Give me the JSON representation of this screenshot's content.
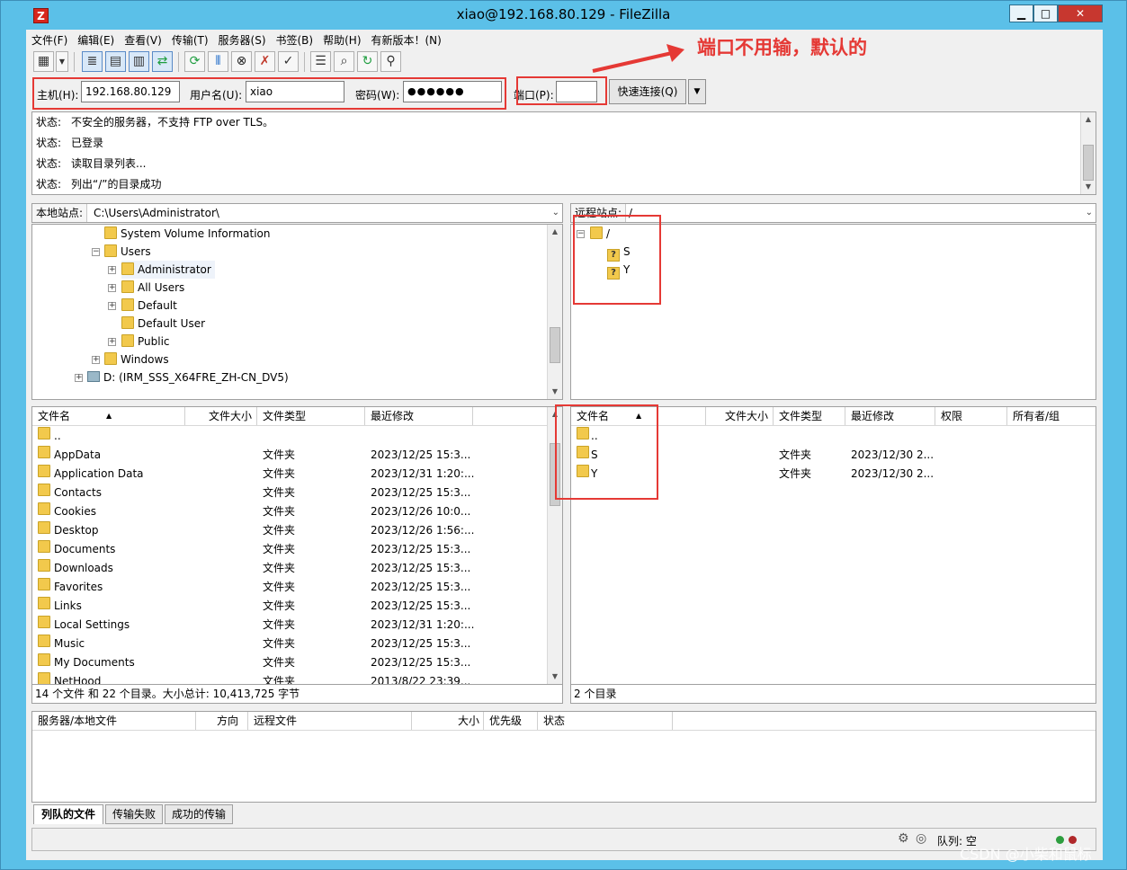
{
  "window": {
    "title": "xiao@192.168.80.129 - FileZilla",
    "app_icon_glyph": "Z",
    "minimize": "▁",
    "maximize": "□",
    "close": "✕"
  },
  "menu": [
    "文件(F)",
    "编辑(E)",
    "查看(V)",
    "传输(T)",
    "服务器(S)",
    "书签(B)",
    "帮助(H)",
    "有新版本！(N)"
  ],
  "toolbar": {
    "icons": [
      "site-manager-icon",
      "dropdown-arrow-icon",
      "toggle-log-icon",
      "toggle-local-tree-icon",
      "toggle-remote-tree-icon",
      "toggle-queue-icon",
      "refresh-icon",
      "process-queue-icon",
      "cancel-icon",
      "disconnect-icon",
      "reconnect-icon",
      "filter-icon",
      "compare-icon",
      "sync-browse-icon",
      "search-icon"
    ]
  },
  "quickconnect": {
    "host_label": "主机(H):",
    "host_value": "192.168.80.129",
    "user_label": "用户名(U):",
    "user_value": "xiao",
    "pass_label": "密码(W):",
    "pass_value": "●●●●●●",
    "port_label": "端口(P):",
    "port_value": "",
    "connect_button": "快速连接(Q)",
    "dropdown": "▼"
  },
  "annotation": {
    "text": "端口不用输，默认的",
    "color": "#e53935"
  },
  "log": [
    {
      "key": "状态:",
      "msg": "不安全的服务器，不支持 FTP over TLS。"
    },
    {
      "key": "状态:",
      "msg": "已登录"
    },
    {
      "key": "状态:",
      "msg": "读取目录列表..."
    },
    {
      "key": "状态:",
      "msg": "列出“/”的目录成功"
    }
  ],
  "local": {
    "site_label": "本地站点:",
    "path": "C:\\Users\\Administrator\\",
    "tree": [
      {
        "name": "System Volume Information",
        "expander": ""
      },
      {
        "name": "Users",
        "expander": "−"
      },
      {
        "name": "Administrator",
        "expander": "+"
      },
      {
        "name": "All Users",
        "expander": "+"
      },
      {
        "name": "Default",
        "expander": "+"
      },
      {
        "name": "Default User",
        "expander": ""
      },
      {
        "name": "Public",
        "expander": "+"
      },
      {
        "name": "Windows",
        "expander": "+"
      },
      {
        "name": "D: (IRM_SSS_X64FRE_ZH-CN_DV5)",
        "expander": "+"
      }
    ],
    "columns": [
      "文件名",
      "文件大小",
      "文件类型",
      "最近修改"
    ],
    "sort_arrow": "▲",
    "files": [
      {
        "name": "..",
        "size": "",
        "type": "",
        "modified": ""
      },
      {
        "name": "AppData",
        "size": "",
        "type": "文件夹",
        "modified": "2023/12/25 15:3..."
      },
      {
        "name": "Application Data",
        "size": "",
        "type": "文件夹",
        "modified": "2023/12/31 1:20:..."
      },
      {
        "name": "Contacts",
        "size": "",
        "type": "文件夹",
        "modified": "2023/12/25 15:3..."
      },
      {
        "name": "Cookies",
        "size": "",
        "type": "文件夹",
        "modified": "2023/12/26 10:0..."
      },
      {
        "name": "Desktop",
        "size": "",
        "type": "文件夹",
        "modified": "2023/12/26 1:56:..."
      },
      {
        "name": "Documents",
        "size": "",
        "type": "文件夹",
        "modified": "2023/12/25 15:3..."
      },
      {
        "name": "Downloads",
        "size": "",
        "type": "文件夹",
        "modified": "2023/12/25 15:3..."
      },
      {
        "name": "Favorites",
        "size": "",
        "type": "文件夹",
        "modified": "2023/12/25 15:3..."
      },
      {
        "name": "Links",
        "size": "",
        "type": "文件夹",
        "modified": "2023/12/25 15:3..."
      },
      {
        "name": "Local Settings",
        "size": "",
        "type": "文件夹",
        "modified": "2023/12/31 1:20:..."
      },
      {
        "name": "Music",
        "size": "",
        "type": "文件夹",
        "modified": "2023/12/25 15:3..."
      },
      {
        "name": "My Documents",
        "size": "",
        "type": "文件夹",
        "modified": "2023/12/25 15:3..."
      },
      {
        "name": "NetHood",
        "size": "",
        "type": "文件夹",
        "modified": "2013/8/22 23:39..."
      }
    ],
    "status": "14 个文件 和 22 个目录。大小总计: 10,413,725 字节"
  },
  "remote": {
    "site_label": "远程站点:",
    "path": "/",
    "tree": [
      {
        "name": "/",
        "expander": "−"
      },
      {
        "name": "S",
        "expander": "",
        "glyph": "?"
      },
      {
        "name": "Y",
        "expander": "",
        "glyph": "?"
      }
    ],
    "columns": [
      "文件名",
      "文件大小",
      "文件类型",
      "最近修改",
      "权限",
      "所有者/组"
    ],
    "sort_arrow": "▲",
    "files": [
      {
        "name": "..",
        "type": "",
        "modified": ""
      },
      {
        "name": "S",
        "type": "文件夹",
        "modified": "2023/12/30 2..."
      },
      {
        "name": "Y",
        "type": "文件夹",
        "modified": "2023/12/30 2..."
      }
    ],
    "status": "2 个目录"
  },
  "queue": {
    "columns": [
      "服务器/本地文件",
      "方向",
      "远程文件",
      "大小",
      "优先级",
      "状态"
    ],
    "tabs": [
      "列队的文件",
      "传输失败",
      "成功的传输"
    ]
  },
  "statusbar": {
    "queue_text": "队列: 空"
  },
  "watermark": "CSDN @小柴和鼠标"
}
